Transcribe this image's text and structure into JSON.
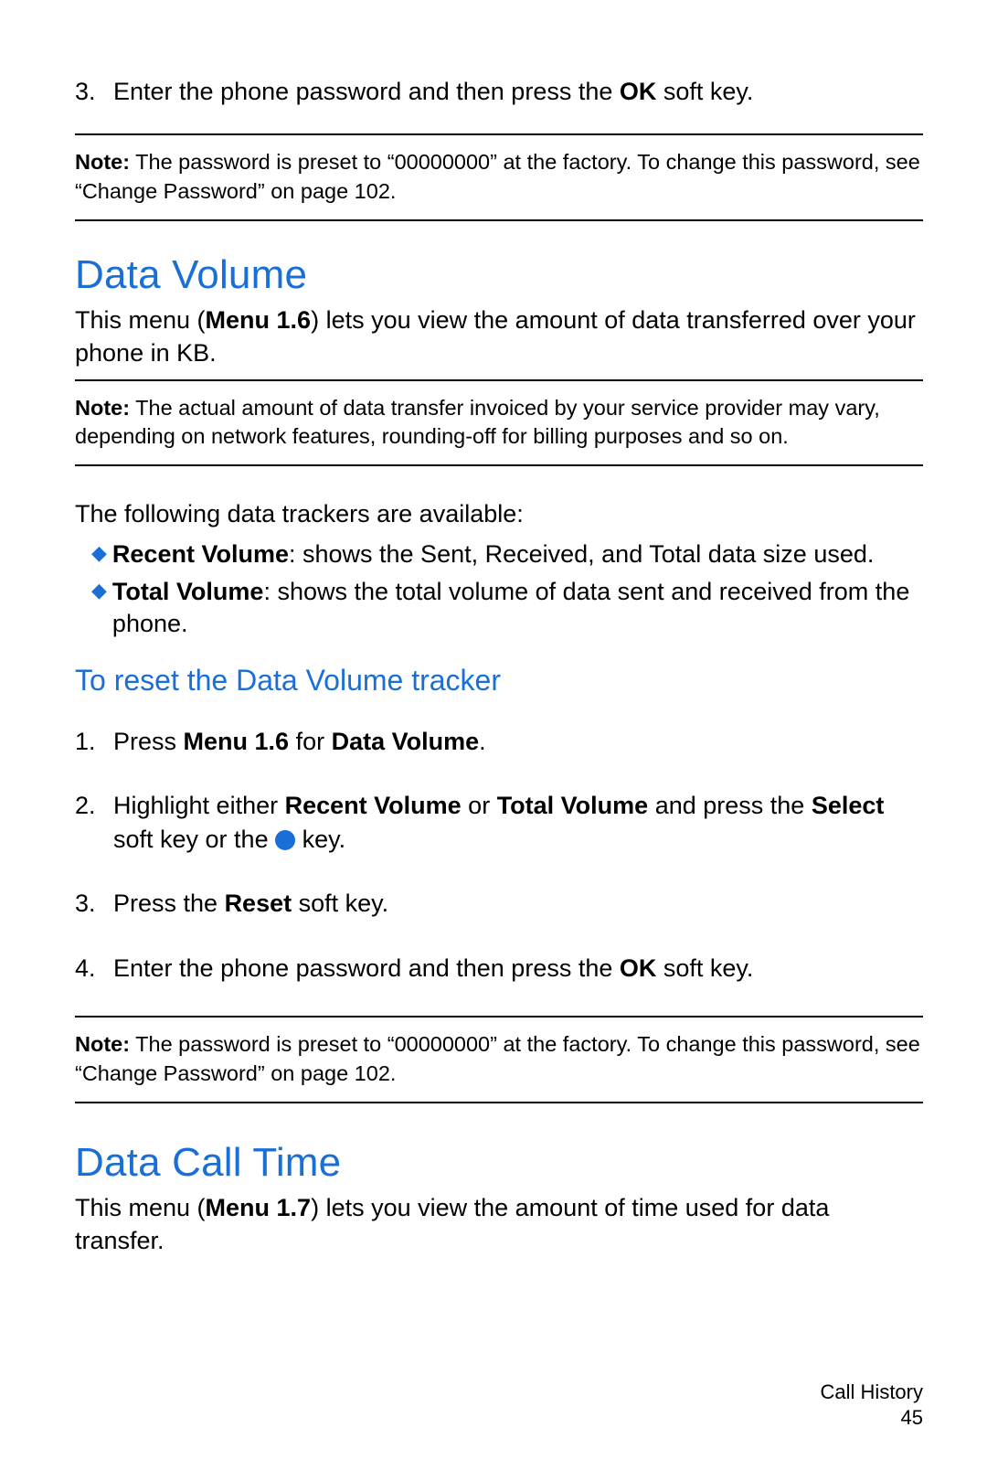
{
  "topStep": {
    "num": "3.",
    "pre": "Enter the phone password and then press the ",
    "bold": "OK",
    "post": " soft key."
  },
  "note1": {
    "label": "Note:",
    "text": " The password is preset to “00000000” at the factory. To change this password, see “Change Password” on page 102."
  },
  "section1": {
    "heading": "Data Volume",
    "intro_pre": "This menu (",
    "intro_bold": "Menu 1.6",
    "intro_post": ") lets you view the amount of data transferred over your phone in KB.",
    "note": {
      "label": "Note:",
      "text": " The actual amount of data transfer invoiced by your service provider may vary, depending on network features, rounding-off for billing purposes and so on."
    },
    "trackers_intro": "The following data trackers are available:",
    "bullets": [
      {
        "term": "Recent Volume",
        "desc": ": shows the Sent, Received, and Total data size used."
      },
      {
        "term": "Total Volume",
        "desc": ": shows the total volume of data sent and received from the phone."
      }
    ],
    "subheading": "To reset the Data Volume tracker",
    "steps": {
      "s1": {
        "num": "1.",
        "pre": "Press ",
        "b1": "Menu 1.6",
        "mid": " for ",
        "b2": "Data Volume",
        "post": "."
      },
      "s2": {
        "num": "2.",
        "pre": "Highlight either ",
        "b1": "Recent Volume",
        "mid1": " or ",
        "b2": "Total Volume",
        "mid2": " and press the ",
        "b3": "Select",
        "mid3": " soft key or the ",
        "post": " key."
      },
      "s3": {
        "num": "3.",
        "pre": "Press the ",
        "b1": "Reset",
        "post": " soft key."
      },
      "s4": {
        "num": "4.",
        "pre": "Enter the phone password and then press the ",
        "b1": "OK",
        "post": " soft key."
      }
    },
    "note2": {
      "label": "Note:",
      "text": " The password is preset to “00000000” at the factory. To change this password, see “Change Password” on page 102."
    }
  },
  "section2": {
    "heading": "Data Call Time",
    "intro_pre": "This menu (",
    "intro_bold": "Menu 1.7",
    "intro_post": ") lets you view the amount of time used for data transfer."
  },
  "footer": {
    "section": "Call History",
    "page": "45"
  }
}
